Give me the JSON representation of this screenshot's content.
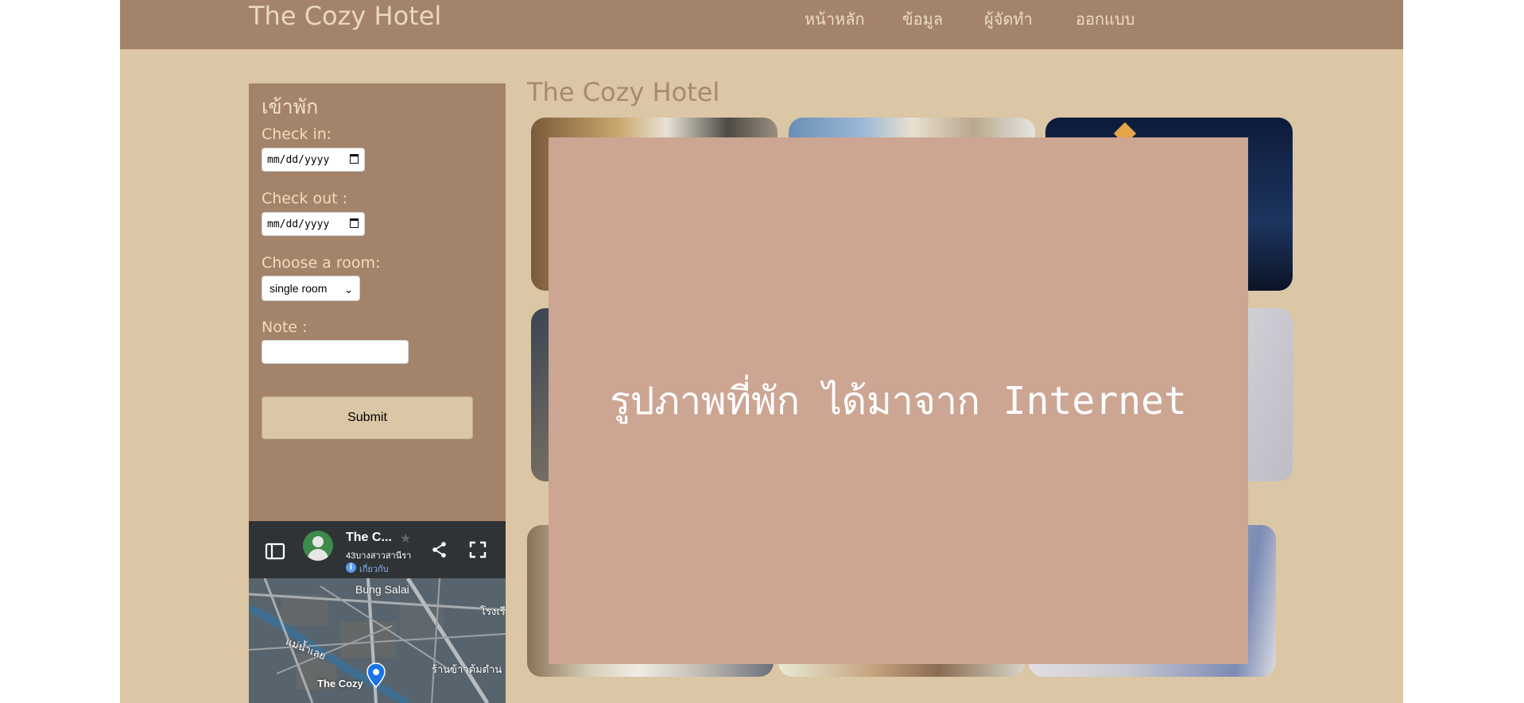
{
  "header": {
    "brand": "The Cozy Hotel",
    "nav": [
      "หน้าหลัก",
      "ข้อมูล",
      "ผู้จัดทำ",
      "ออกแบบ"
    ]
  },
  "sidebar": {
    "title": "เข้าพัก",
    "checkin_label": "Check in:",
    "checkin_value": "mm/dd/yyyy",
    "checkout_label": "Check out :",
    "checkout_value": "mm/dd/yyyy",
    "room_label": "Choose a room:",
    "room_selected": "single room",
    "note_label": "Note :",
    "note_value": "",
    "submit_label": "Submit"
  },
  "map": {
    "place_name": "The C...",
    "address": "43บางสาวสานีรา",
    "about_link": "เกี่ยวกับ",
    "area_label": "Bung Salai",
    "river_label": "แม่น้ำเลย",
    "school_label": "โรงเรี",
    "shop_label": "ร้านข้าวต้มตำน",
    "pin_label": "The Cozy"
  },
  "main": {
    "title": "The Cozy Hotel",
    "overlay_text": "รูปภาพที่พัก ได้มาจาก Internet"
  },
  "colors": {
    "page_bg": "#dbc6a5",
    "header_bg": "#a4836b",
    "overlay_bg": "#cca593"
  }
}
